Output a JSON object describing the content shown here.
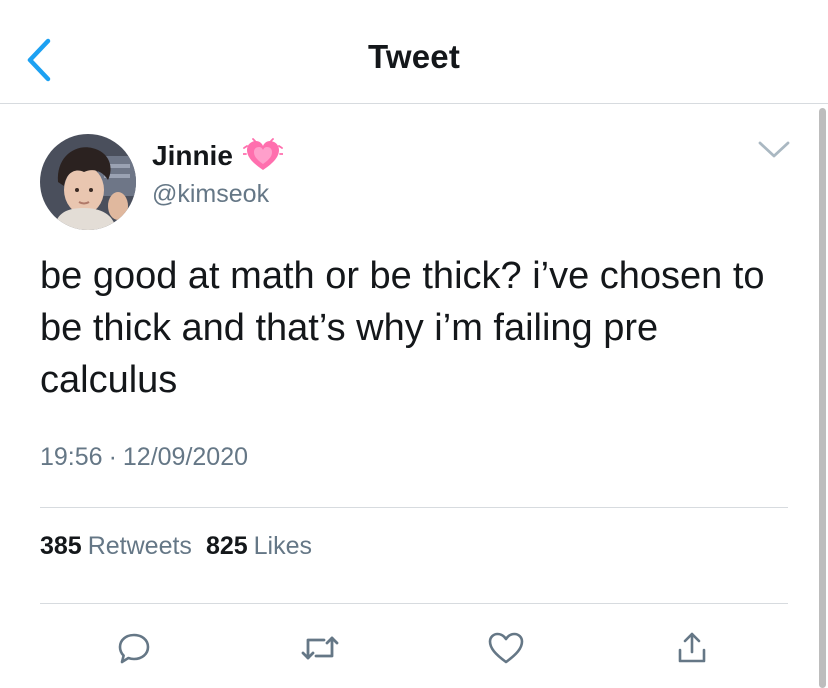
{
  "header": {
    "title": "Tweet",
    "back_icon": "chevron-left-icon",
    "accent_color": "#1da1f2"
  },
  "tweet": {
    "author": {
      "display_name": "Jinnie",
      "emoji_icon": "growing-heart-emoji",
      "handle": "@kimseok"
    },
    "text": "be good at math or be thick? i’ve chosen to be thick and that’s why i’m failing pre calculus",
    "time": "19:56",
    "separator": "·",
    "date": "12/09/2020",
    "stats": {
      "retweets_count": "385",
      "retweets_label": "Retweets",
      "likes_count": "825",
      "likes_label": "Likes"
    },
    "actions": [
      "reply-icon",
      "retweet-icon",
      "like-icon",
      "share-icon"
    ]
  },
  "colors": {
    "primary_text": "#14171a",
    "secondary_text": "#657786",
    "divider": "#d7dbdf"
  }
}
